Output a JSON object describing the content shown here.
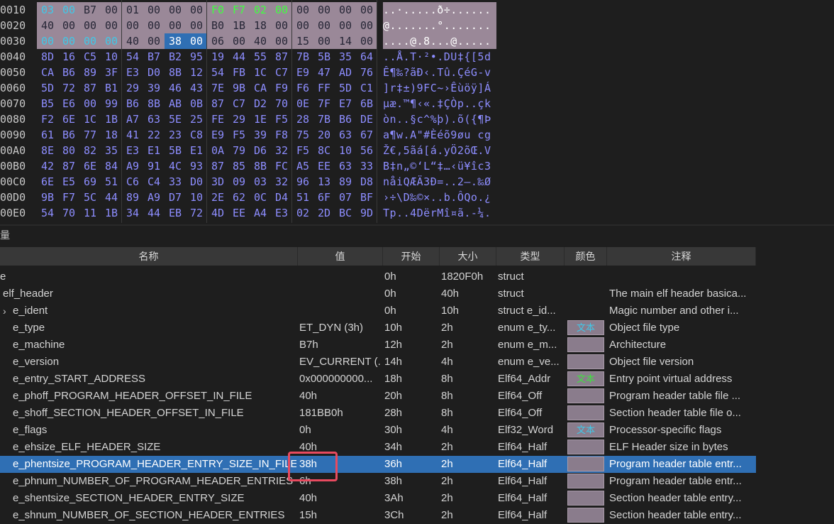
{
  "hex": {
    "rows": [
      {
        "addr": "0010",
        "bytes": [
          "03",
          "00",
          "B7",
          "00",
          "01",
          "00",
          "00",
          "00",
          "F0",
          "F7",
          "02",
          "00",
          "00",
          "00",
          "00",
          "00"
        ],
        "ascii": "..·.....ð÷......"
      },
      {
        "addr": "0020",
        "bytes": [
          "40",
          "00",
          "00",
          "00",
          "00",
          "00",
          "00",
          "00",
          "B0",
          "1B",
          "18",
          "00",
          "00",
          "00",
          "00",
          "00"
        ],
        "ascii": "@.......°......."
      },
      {
        "addr": "0030",
        "bytes": [
          "00",
          "00",
          "00",
          "00",
          "40",
          "00",
          "38",
          "00",
          "06",
          "00",
          "40",
          "00",
          "15",
          "00",
          "14",
          "00"
        ],
        "ascii": "....@.8...@....."
      },
      {
        "addr": "0040",
        "bytes": [
          "8D",
          "16",
          "C5",
          "10",
          "54",
          "B7",
          "B2",
          "95",
          "19",
          "44",
          "55",
          "87",
          "7B",
          "5B",
          "35",
          "64"
        ],
        "ascii": "..Å.T·²•.DU‡{[5d"
      },
      {
        "addr": "0050",
        "bytes": [
          "CA",
          "B6",
          "89",
          "3F",
          "E3",
          "D0",
          "8B",
          "12",
          "54",
          "FB",
          "1C",
          "C7",
          "E9",
          "47",
          "AD",
          "76"
        ],
        "ascii": "Ê¶‰?ãÐ‹.Tû.ÇéG-v"
      },
      {
        "addr": "0060",
        "bytes": [
          "5D",
          "72",
          "87",
          "B1",
          "29",
          "39",
          "46",
          "43",
          "7E",
          "9B",
          "CA",
          "F9",
          "F6",
          "FF",
          "5D",
          "C1"
        ],
        "ascii": "]r‡±)9FC~›Êùöÿ]Á"
      },
      {
        "addr": "0070",
        "bytes": [
          "B5",
          "E6",
          "00",
          "99",
          "B6",
          "8B",
          "AB",
          "0B",
          "87",
          "C7",
          "D2",
          "70",
          "0E",
          "7F",
          "E7",
          "6B"
        ],
        "ascii": "µæ.™¶‹«.‡ÇÒp..çk"
      },
      {
        "addr": "0080",
        "bytes": [
          "F2",
          "6E",
          "1C",
          "1B",
          "A7",
          "63",
          "5E",
          "25",
          "FE",
          "29",
          "1E",
          "F5",
          "28",
          "7B",
          "B6",
          "DE"
        ],
        "ascii": "òn..§c^%þ).õ({¶Þ"
      },
      {
        "addr": "0090",
        "bytes": [
          "61",
          "B6",
          "77",
          "18",
          "41",
          "22",
          "23",
          "C8",
          "E9",
          "F5",
          "39",
          "F8",
          "75",
          "20",
          "63",
          "67"
        ],
        "ascii": "a¶w.A\"#Èéõ9øu cg"
      },
      {
        "addr": "00A0",
        "bytes": [
          "8E",
          "80",
          "82",
          "35",
          "E3",
          "E1",
          "5B",
          "E1",
          "0A",
          "79",
          "D6",
          "32",
          "F5",
          "8C",
          "10",
          "56"
        ],
        "ascii": "Ž€,5ãá[á.yÖ2õŒ.V"
      },
      {
        "addr": "00B0",
        "bytes": [
          "42",
          "87",
          "6E",
          "84",
          "A9",
          "91",
          "4C",
          "93",
          "87",
          "85",
          "8B",
          "FC",
          "A5",
          "EE",
          "63",
          "33"
        ],
        "ascii": "B‡n„©‘L“‡…‹ü¥îc3"
      },
      {
        "addr": "00C0",
        "bytes": [
          "6E",
          "E5",
          "69",
          "51",
          "C6",
          "C4",
          "33",
          "D0",
          "3D",
          "09",
          "03",
          "32",
          "96",
          "13",
          "89",
          "D8"
        ],
        "ascii": "nåiQÆÄ3Ð=..2–.‰Ø"
      },
      {
        "addr": "00D0",
        "bytes": [
          "9B",
          "F7",
          "5C",
          "44",
          "89",
          "A9",
          "D7",
          "10",
          "2E",
          "62",
          "0C",
          "D4",
          "51",
          "6F",
          "07",
          "BF"
        ],
        "ascii": "›÷\\D‰©×..b.ÔQo.¿"
      },
      {
        "addr": "00E0",
        "bytes": [
          "54",
          "70",
          "11",
          "1B",
          "34",
          "44",
          "EB",
          "72",
          "4D",
          "EE",
          "A4",
          "E3",
          "02",
          "2D",
          "BC",
          "9D"
        ],
        "ascii": "Tp..4DërMî¤ã.-¼."
      }
    ]
  },
  "panel": {
    "title": "量"
  },
  "table": {
    "headers": {
      "name": "名称",
      "value": "值",
      "start": "开始",
      "size": "大小",
      "type": "类型",
      "color": "颜色",
      "comment": "注释"
    },
    "rows": [
      {
        "name": "e",
        "value": "",
        "start": "0h",
        "size": "1820F0h",
        "type": "struct",
        "color": "",
        "comment": ""
      },
      {
        "name": "elf_header",
        "value": "",
        "start": "0h",
        "size": "40h",
        "type": "struct",
        "color": "",
        "comment": "The main elf header basica..."
      },
      {
        "name": "e_ident",
        "value": "",
        "start": "0h",
        "size": "10h",
        "type": "struct e_id...",
        "color": "",
        "comment": "Magic number and other i..."
      },
      {
        "name": "e_type",
        "value": "ET_DYN (3h)",
        "start": "10h",
        "size": "2h",
        "type": "enum e_ty...",
        "color": "文本",
        "comment": "Object file type"
      },
      {
        "name": "e_machine",
        "value": "B7h",
        "start": "12h",
        "size": "2h",
        "type": "enum e_m...",
        "color": "",
        "comment": "Architecture"
      },
      {
        "name": "e_version",
        "value": "EV_CURRENT (...",
        "start": "14h",
        "size": "4h",
        "type": "enum e_ve...",
        "color": "",
        "comment": "Object file version"
      },
      {
        "name": "e_entry_START_ADDRESS",
        "value": "0x000000000...",
        "start": "18h",
        "size": "8h",
        "type": "Elf64_Addr",
        "color": "文本",
        "comment": "Entry point virtual address"
      },
      {
        "name": "e_phoff_PROGRAM_HEADER_OFFSET_IN_FILE",
        "value": "40h",
        "start": "20h",
        "size": "8h",
        "type": "Elf64_Off",
        "color": "",
        "comment": "Program header table file ..."
      },
      {
        "name": "e_shoff_SECTION_HEADER_OFFSET_IN_FILE",
        "value": "181BB0h",
        "start": "28h",
        "size": "8h",
        "type": "Elf64_Off",
        "color": "",
        "comment": "Section header table file o..."
      },
      {
        "name": "e_flags",
        "value": "0h",
        "start": "30h",
        "size": "4h",
        "type": "Elf32_Word",
        "color": "文本",
        "comment": "Processor-specific flags"
      },
      {
        "name": "e_ehsize_ELF_HEADER_SIZE",
        "value": "40h",
        "start": "34h",
        "size": "2h",
        "type": "Elf64_Half",
        "color": "",
        "comment": "ELF Header size in bytes"
      },
      {
        "name": "e_phentsize_PROGRAM_HEADER_ENTRY_SIZE_IN_FILE",
        "value": "38h",
        "start": "36h",
        "size": "2h",
        "type": "Elf64_Half",
        "color": "",
        "comment": "Program header table entr..."
      },
      {
        "name": "e_phnum_NUMBER_OF_PROGRAM_HEADER_ENTRIES",
        "value": "6h",
        "start": "38h",
        "size": "2h",
        "type": "Elf64_Half",
        "color": "",
        "comment": "Program header table entr..."
      },
      {
        "name": "e_shentsize_SECTION_HEADER_ENTRY_SIZE",
        "value": "40h",
        "start": "3Ah",
        "size": "2h",
        "type": "Elf64_Half",
        "color": "",
        "comment": "Section header table entry..."
      },
      {
        "name": "e_shnum_NUMBER_OF_SECTION_HEADER_ENTRIES",
        "value": "15h",
        "start": "3Ch",
        "size": "2h",
        "type": "Elf64_Half",
        "color": "",
        "comment": "Section header table entry..."
      }
    ],
    "selected_index": 11,
    "colors": {
      "cyan_text": "#40c8e8",
      "green_text": "#40e040",
      "selection": "#2f6fb4",
      "highlight_border": "#e84a5f"
    }
  }
}
